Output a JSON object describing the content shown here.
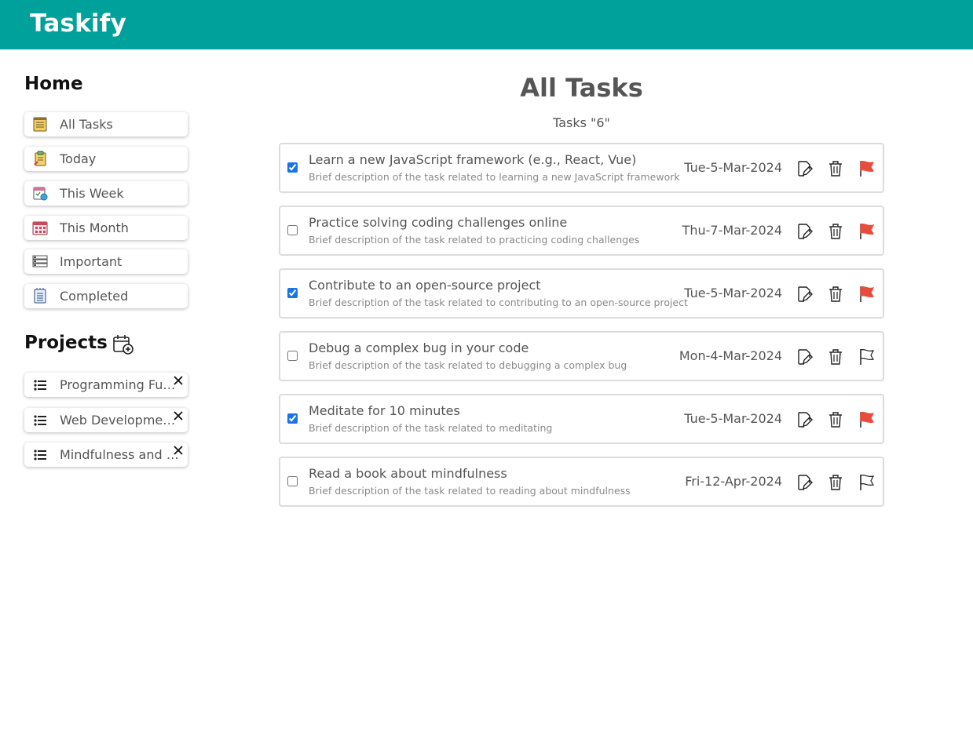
{
  "app": {
    "title": "Taskify"
  },
  "sidebar": {
    "home_heading": "Home",
    "nav": [
      {
        "label": "All Tasks",
        "icon": "notepad-icon"
      },
      {
        "label": "Today",
        "icon": "clipboard-icon"
      },
      {
        "label": "This Week",
        "icon": "week-calendar-icon"
      },
      {
        "label": "This Month",
        "icon": "month-calendar-icon"
      },
      {
        "label": "Important",
        "icon": "important-list-icon"
      },
      {
        "label": "Completed",
        "icon": "checklist-icon"
      }
    ],
    "projects_heading": "Projects",
    "add_project_icon": "calendar-plus-icon",
    "projects": [
      {
        "label": "Programming Fundamentals",
        "icon": "list-icon"
      },
      {
        "label": "Web Development Projects",
        "icon": "list-icon"
      },
      {
        "label": "Mindfulness and Meditation",
        "icon": "list-icon"
      }
    ]
  },
  "main": {
    "title": "All Tasks",
    "count_text": "Tasks \"6\"",
    "tasks": [
      {
        "title": "Learn a new JavaScript framework (e.g., React, Vue)",
        "description": "Brief description of the task related to learning a new JavaScript framework",
        "date": "Tue-5-Mar-2024",
        "completed": true,
        "important": true
      },
      {
        "title": "Practice solving coding challenges online",
        "description": "Brief description of the task related to practicing coding challenges",
        "date": "Thu-7-Mar-2024",
        "completed": false,
        "important": true
      },
      {
        "title": "Contribute to an open-source project",
        "description": "Brief description of the task related to contributing to an open-source project",
        "date": "Tue-5-Mar-2024",
        "completed": true,
        "important": true
      },
      {
        "title": "Debug a complex bug in your code",
        "description": "Brief description of the task related to debugging a complex bug",
        "date": "Mon-4-Mar-2024",
        "completed": false,
        "important": false
      },
      {
        "title": "Meditate for 10 minutes",
        "description": "Brief description of the task related to meditating",
        "date": "Tue-5-Mar-2024",
        "completed": true,
        "important": true
      },
      {
        "title": "Read a book about mindfulness",
        "description": "Brief description of the task related to reading about mindfulness",
        "date": "Fri-12-Apr-2024",
        "completed": false,
        "important": false
      }
    ]
  },
  "colors": {
    "header": "#00a19b",
    "flag_important": "#e84c3d",
    "checkbox": "#1a73e8"
  }
}
